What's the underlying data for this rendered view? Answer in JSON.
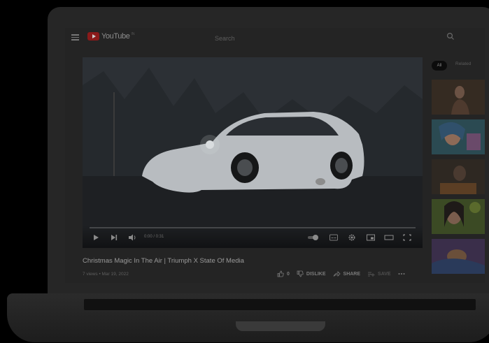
{
  "header": {
    "logo_text": "YouTube",
    "logo_region": "IN",
    "search_placeholder": "Search"
  },
  "player": {
    "time_display": "0:00 / 0:31"
  },
  "video": {
    "title": "Christmas Magic In The Air | Triumph X State Of Media",
    "meta": "7 views • Mar 19, 2022",
    "like_count": "0",
    "dislike_label": "DISLIKE",
    "share_label": "SHARE",
    "save_label": "SAVE"
  },
  "related": {
    "chips": [
      "All",
      "Related"
    ]
  },
  "colors": {
    "brand_red": "#8a1a1a",
    "background": "#000000",
    "screen": "#242424"
  },
  "icons": [
    "menu-icon",
    "search-icon",
    "play-icon",
    "next-icon",
    "volume-icon",
    "autoplay-toggle-icon",
    "captions-icon",
    "settings-icon",
    "miniplayer-icon",
    "theater-icon",
    "fullscreen-icon",
    "like-icon",
    "dislike-icon",
    "share-icon",
    "save-icon",
    "more-icon"
  ]
}
